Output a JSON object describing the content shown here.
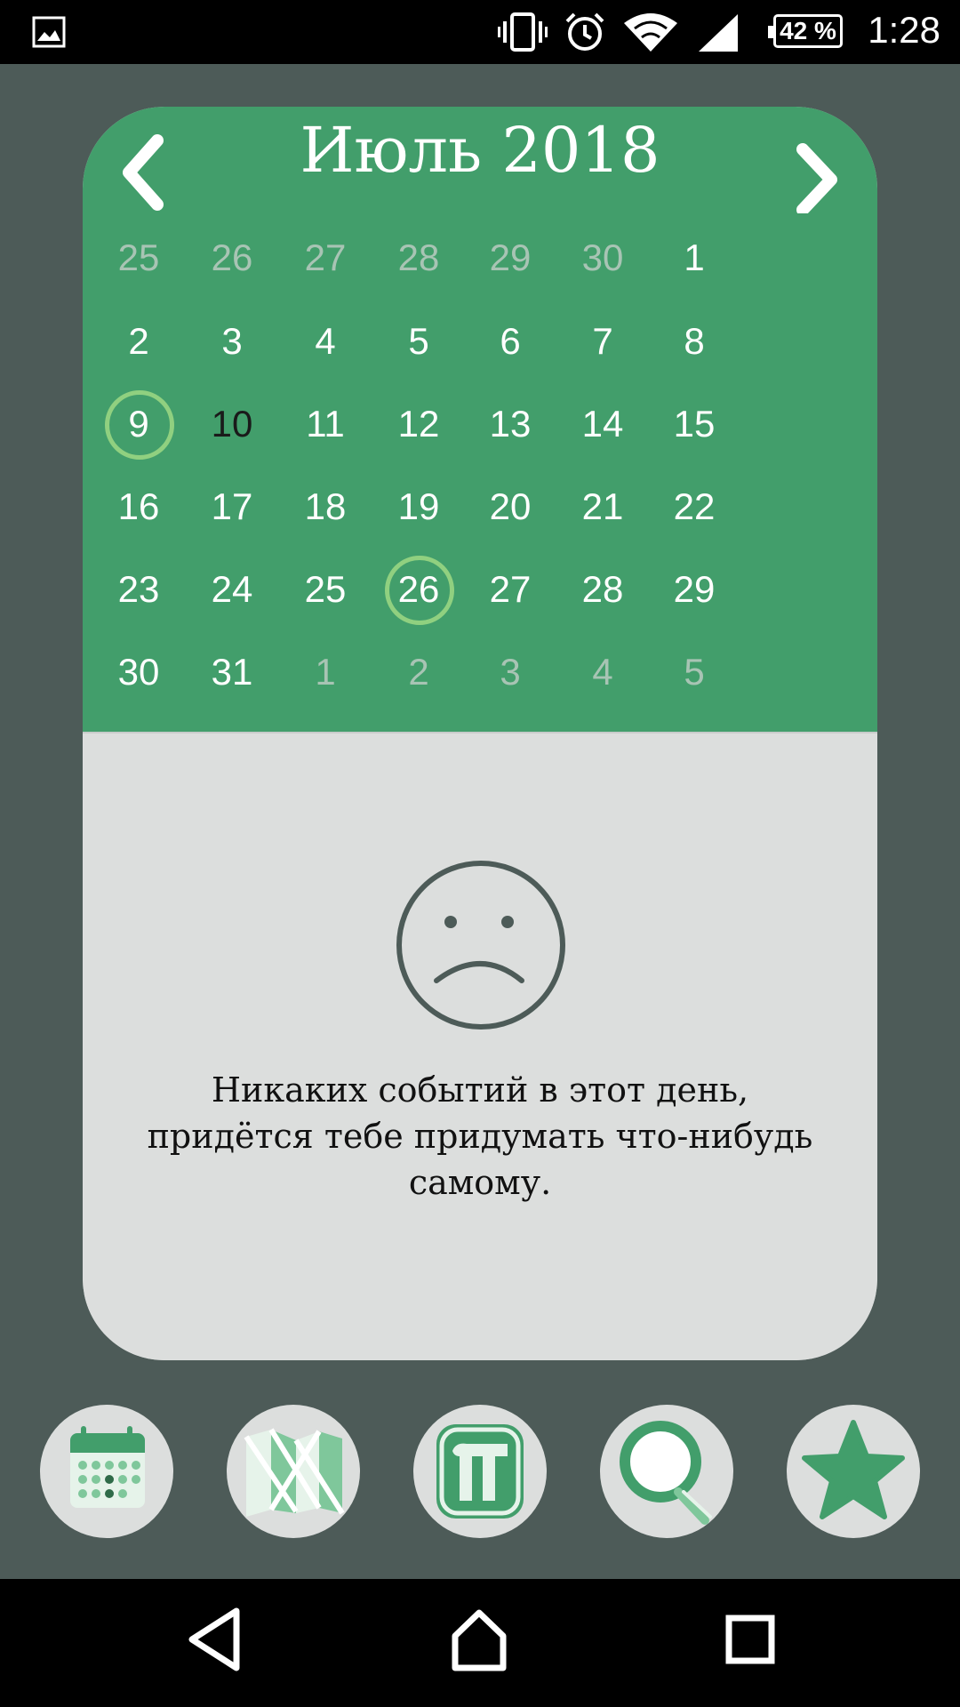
{
  "status_bar": {
    "time": "1:28",
    "battery": "42 %",
    "icons": [
      "image-notification-icon",
      "vibrate-icon",
      "alarm-icon",
      "wifi-icon",
      "signal-icon",
      "battery-icon"
    ]
  },
  "calendar": {
    "title": "Июль 2018",
    "prev_icon": "chevron-left-icon",
    "next_icon": "chevron-right-icon",
    "weeks": [
      [
        "25",
        "26",
        "27",
        "28",
        "29",
        "30",
        "1"
      ],
      [
        "2",
        "3",
        "4",
        "5",
        "6",
        "7",
        "8"
      ],
      [
        "9",
        "10",
        "11",
        "12",
        "13",
        "14",
        "15"
      ],
      [
        "16",
        "17",
        "18",
        "19",
        "20",
        "21",
        "22"
      ],
      [
        "23",
        "24",
        "25",
        "26",
        "27",
        "28",
        "29"
      ],
      [
        "30",
        "31",
        "1",
        "2",
        "3",
        "4",
        "5"
      ]
    ],
    "accent_color": "#429e6b",
    "ring_color": "#90d080"
  },
  "empty_state": {
    "icon": "sad-face-icon",
    "message_line1": "Никаких событий в этот день,",
    "message_line2": "придётся тебе придумать что-нибудь",
    "message_line3": "самому."
  },
  "bottom_apps": [
    "calendar-app-icon",
    "map-app-icon",
    "pi-app-icon",
    "search-app-icon",
    "favorites-star-icon"
  ],
  "nav_bar": [
    "back-icon",
    "home-icon",
    "recents-icon"
  ]
}
